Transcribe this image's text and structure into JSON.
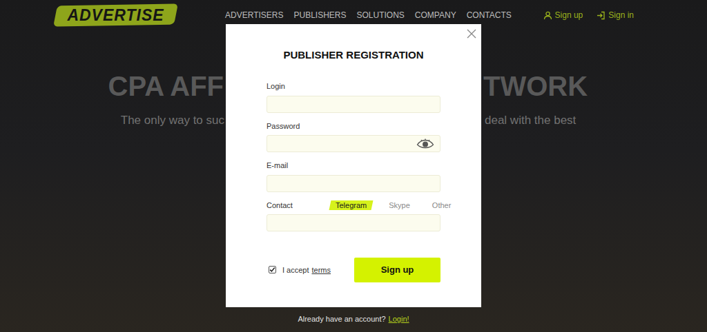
{
  "header": {
    "logo": "ADVERTISE",
    "nav": [
      "ADVERTISERS",
      "PUBLISHERS",
      "SOLUTIONS",
      "COMPANY",
      "CONTACTS"
    ],
    "sign_up": "Sign up",
    "sign_in": "Sign in"
  },
  "hero": {
    "title_left": "CPA AFF",
    "title_right": "TWORK",
    "subtitle_left": "The only way to suc",
    "subtitle_right": "deal with the best"
  },
  "modal": {
    "title": "PUBLISHER REGISTRATION",
    "fields": [
      {
        "label": "Login",
        "kind": "text"
      },
      {
        "label": "Password",
        "kind": "password"
      },
      {
        "label": "E-mail",
        "kind": "text"
      }
    ],
    "contact": {
      "label": "Contact",
      "tabs": [
        {
          "label": "Telegram",
          "selected": true
        },
        {
          "label": "Skype",
          "selected": false
        },
        {
          "label": "Other",
          "selected": false
        }
      ]
    },
    "terms": {
      "checked": true,
      "text": "I accept",
      "link": "terms"
    },
    "submit": "Sign up"
  },
  "footer": {
    "text": "Already have an account?",
    "link": "Login!"
  }
}
